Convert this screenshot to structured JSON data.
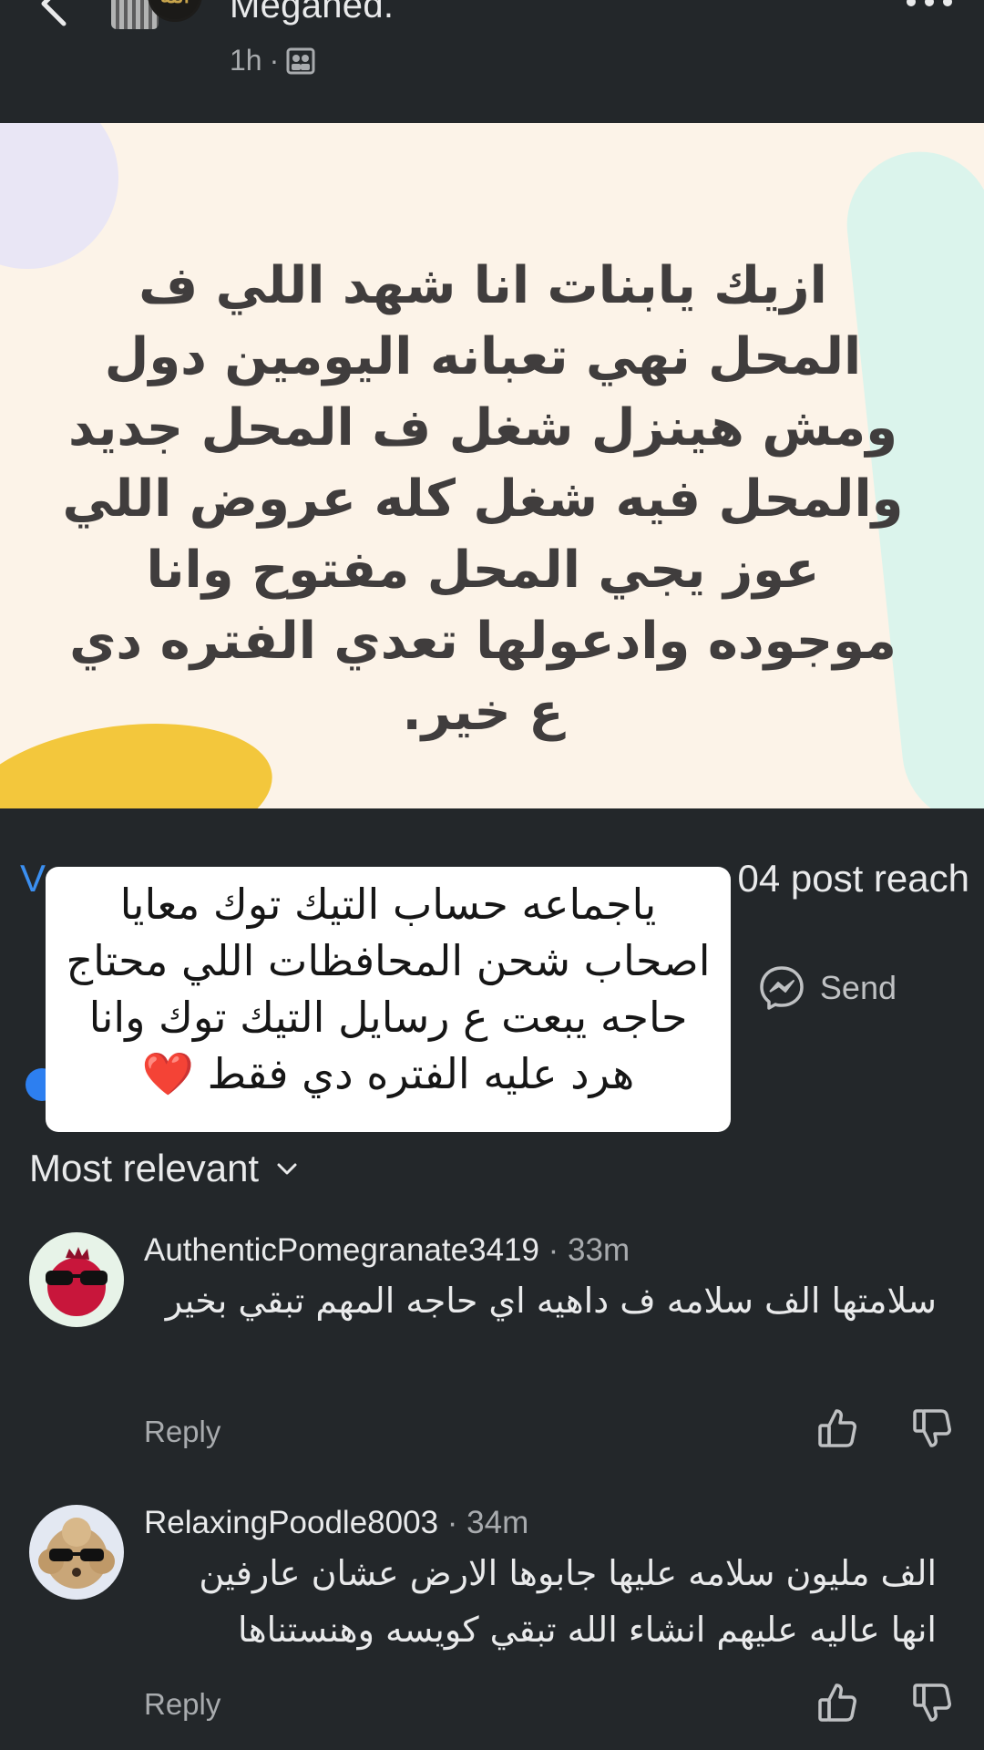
{
  "post": {
    "author_name": "Megahed.",
    "time": "1h",
    "time_separator": "·",
    "body_text": "ازيك يابنات انا شهد اللي ف المحل نهي تعبانه اليومين دول ومش هينزل شغل ف المحل جديد والمحل فيه شغل كله عروض اللي عوز يجي المحل مفتوح وانا موجوده وادعولها تعدي الفتره دي ع خير."
  },
  "stats": {
    "views_partial": "V",
    "reach_partial": "04 post reach",
    "send_label": "Send"
  },
  "overlay": {
    "text": "ياجماعه حساب التيك توك معايا اصحاب شحن المحافظات اللي محتاج حاجه يبعت ع رسايل التيك توك وانا هرد عليه الفتره دي فقط",
    "heart": "❤️"
  },
  "sort": {
    "label": "Most relevant"
  },
  "comments": [
    {
      "author": "AuthenticPomegranate3419",
      "time": " · 33m",
      "text": "سلامتها الف سلامه ف داهيه اي حاجه  المهم تبقي بخير",
      "reply_label": "Reply"
    },
    {
      "author": "RelaxingPoodle8003",
      "time": " · 34m",
      "text": "الف مليون سلامه عليها جابوها الارض عشان عارفين انها عاليه عليهم انشاء الله تبقي كويسه وهنستناها",
      "reply_label": "Reply"
    }
  ],
  "colors": {
    "background": "#23272a",
    "link_blue": "#3b8ff0",
    "post_bg": "#fcf3e8",
    "post_text": "#403d3d"
  },
  "icons": [
    "back-arrow-icon",
    "audience-icon",
    "more-options-icon",
    "messenger-icon",
    "chevron-down-icon",
    "like-icon",
    "dislike-icon"
  ]
}
